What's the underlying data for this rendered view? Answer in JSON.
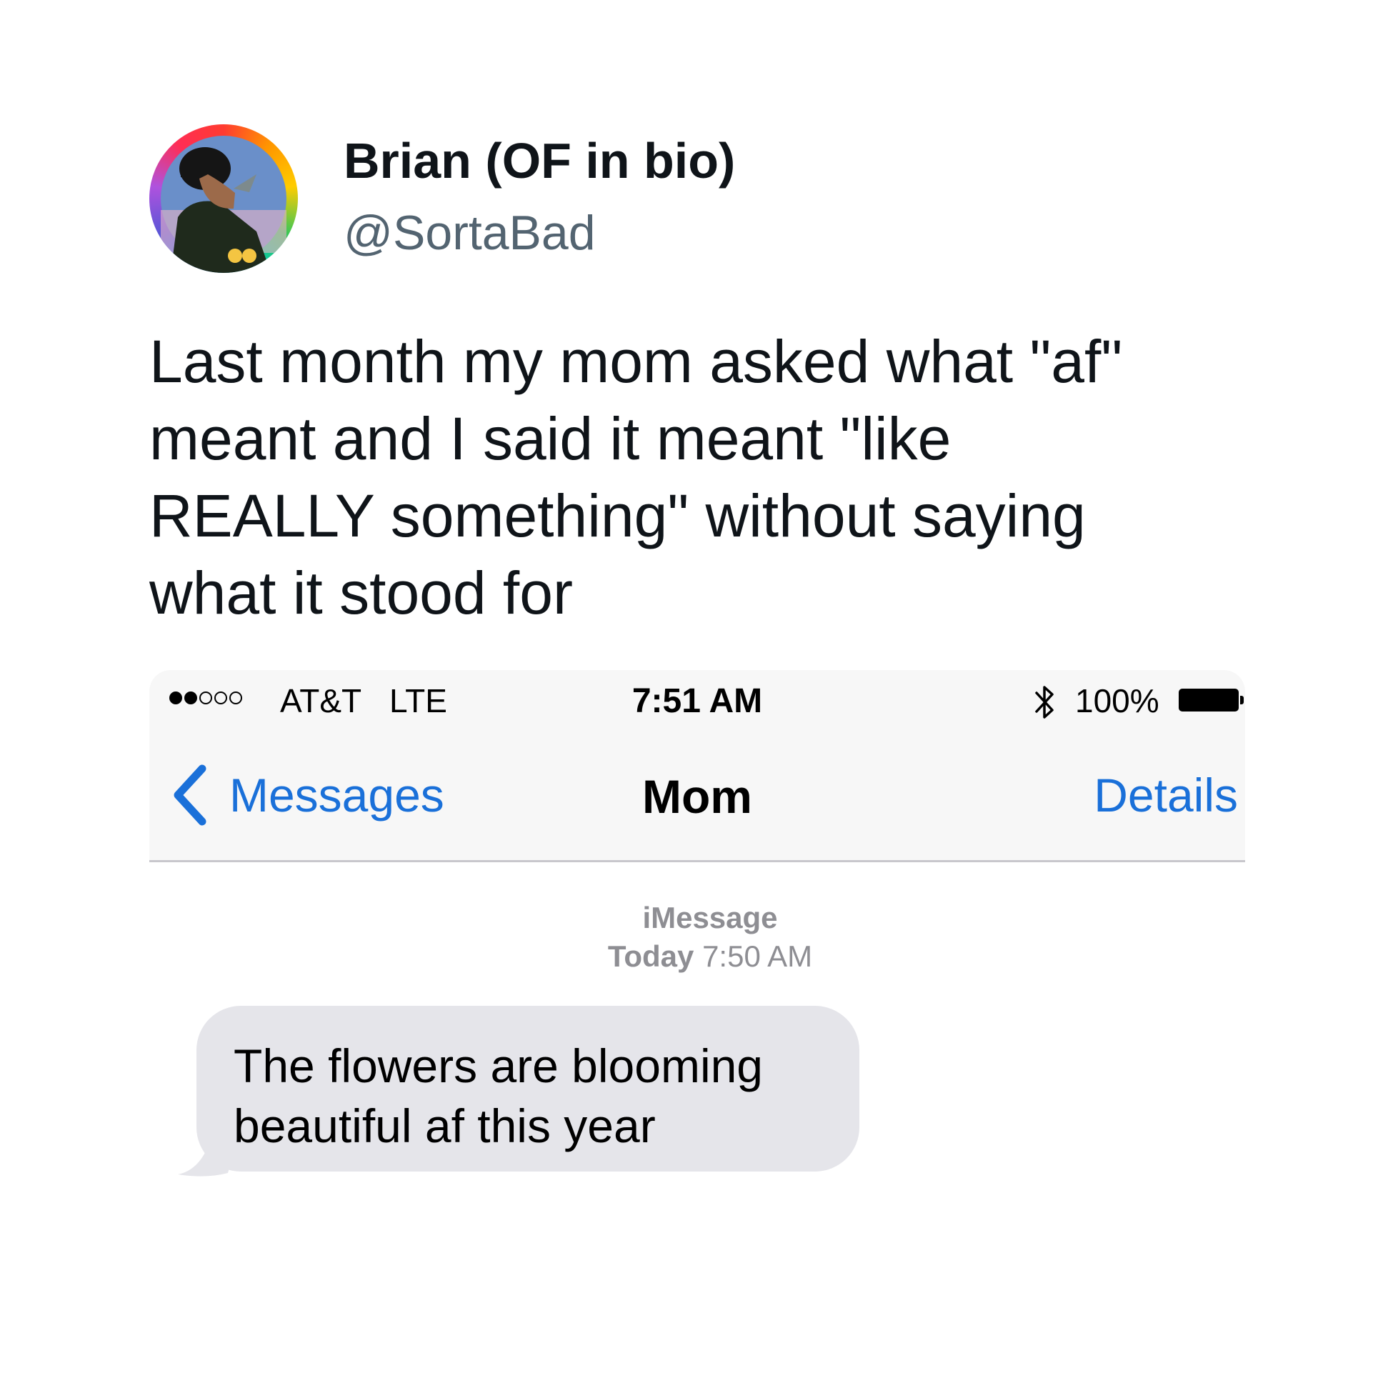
{
  "tweet": {
    "display_name": "Brian (OF in bio)",
    "handle": "@SortaBad",
    "avatar_icon": "profile-avatar",
    "text_lines": [
      "Last month my mom asked what \"af\"",
      "meant and I said it meant \"like",
      "REALLY something\" without saying",
      "what it stood for"
    ]
  },
  "phone": {
    "status_bar": {
      "signal_bars_filled": 2,
      "signal_bars_total": 5,
      "carrier": "AT&T",
      "network": "LTE",
      "time": "7:51 AM",
      "bluetooth_icon": "bluetooth-icon",
      "battery_percent": "100%",
      "battery_level": 1.0
    },
    "nav": {
      "back_icon": "chevron-left-icon",
      "back_label": "Messages",
      "title": "Mom",
      "details_label": "Details",
      "link_color": "#1a70d9"
    },
    "conversation": {
      "service_label": "iMessage",
      "timestamp_day": "Today",
      "timestamp_time": "7:50 AM",
      "messages": [
        {
          "direction": "incoming",
          "lines": [
            "The flowers are blooming",
            "beautiful af this year"
          ]
        }
      ],
      "incoming_bubble_color": "#e5e5ea"
    }
  }
}
